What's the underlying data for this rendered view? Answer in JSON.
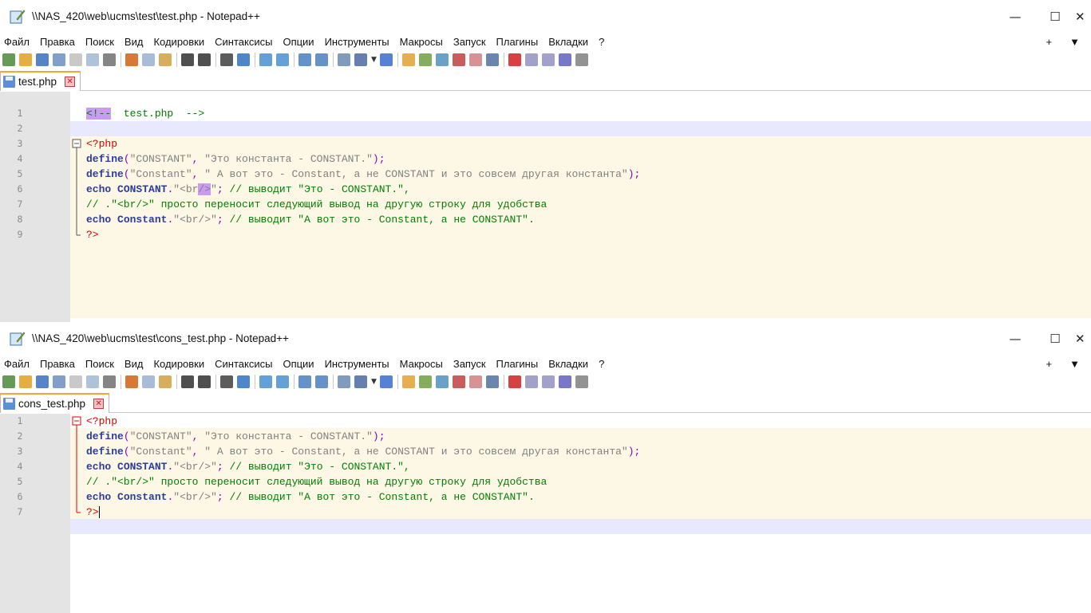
{
  "windows": [
    {
      "title": "\\\\NAS_420\\web\\ucms\\test\\test.php - Notepad++",
      "tab": "test.php",
      "lines": [
        {
          "num": "1",
          "text": [
            "<!--",
            "  test.php  -->"
          ]
        },
        {
          "num": "2",
          "text": [
            ""
          ]
        },
        {
          "num": "3",
          "text": [
            "<?php"
          ]
        },
        {
          "num": "4",
          "text": [
            "define",
            "(",
            "\"CONSTANT\"",
            ", ",
            "\"Это константа - CONSTANT.\"",
            ");"
          ]
        },
        {
          "num": "5",
          "text": [
            "define",
            "(",
            "\"Constant\"",
            ", ",
            "\" А вот это - Constant, а не CONSTANT и это совсем другая константа\"",
            ");"
          ]
        },
        {
          "num": "6",
          "text": [
            "echo",
            " ",
            "CONSTANT",
            ".",
            "\"<br",
            "/>",
            "\"",
            "; ",
            "// выводит \"Это - CONSTANT.\","
          ]
        },
        {
          "num": "7",
          "text": [
            "// .\"<br/>\" просто переносит следующий вывод на другую строку для удобства"
          ]
        },
        {
          "num": "8",
          "text": [
            "echo",
            " ",
            "Constant",
            ".",
            "\"<br/>\"",
            "; ",
            "// выводит \"А вот это - Constant, а не CONSTANT\"."
          ]
        },
        {
          "num": "9",
          "text": [
            "?>"
          ]
        }
      ]
    },
    {
      "title": "\\\\NAS_420\\web\\ucms\\test\\cons_test.php - Notepad++",
      "tab": "cons_test.php",
      "lines": [
        {
          "num": "1",
          "text": [
            "<?php"
          ]
        },
        {
          "num": "2",
          "text": [
            "define",
            "(",
            "\"CONSTANT\"",
            ", ",
            "\"Это константа - CONSTANT.\"",
            ");"
          ]
        },
        {
          "num": "3",
          "text": [
            "define",
            "(",
            "\"Constant\"",
            ", ",
            "\" А вот это - Constant, а не CONSTANT и это совсем другая константа\"",
            ");"
          ]
        },
        {
          "num": "4",
          "text": [
            "echo",
            " ",
            "CONSTANT",
            ".",
            "\"<br/>\"",
            "; ",
            "// выводит \"Это - CONSTANT.\","
          ]
        },
        {
          "num": "5",
          "text": [
            "// .\"<br/>\" просто переносит следующий вывод на другую строку для удобства"
          ]
        },
        {
          "num": "6",
          "text": [
            "echo",
            " ",
            "Constant",
            ".",
            "\"<br/>\"",
            "; ",
            "// выводит \"А вот это - Constant, а не CONSTANT\"."
          ]
        },
        {
          "num": "7",
          "text": [
            "?>"
          ]
        }
      ]
    }
  ],
  "menu": [
    "Файл",
    "Правка",
    "Поиск",
    "Вид",
    "Кодировки",
    "Синтаксисы",
    "Опции",
    "Инструменты",
    "Макросы",
    "Запуск",
    "Плагины",
    "Вкладки",
    "?"
  ],
  "menu_right": [
    "+",
    "▼"
  ],
  "controls": {
    "minimize": "—",
    "maximize": "☐",
    "close": "✕",
    "tab_close": "✕"
  },
  "icons": [
    "new-file-icon",
    "open-file-icon",
    "save-icon",
    "save-all-icon",
    "close-icon",
    "close-all-icon",
    "print-icon",
    "cut-icon",
    "copy-icon",
    "paste-icon",
    "undo-icon",
    "redo-icon",
    "find-icon",
    "replace-icon",
    "zoom-in-icon",
    "zoom-out-icon",
    "sync-vertical-icon",
    "sync-horizontal-icon",
    "word-wrap-icon",
    "show-all-chars-icon",
    "indent-guide-icon",
    "udl-icon",
    "doc-map-icon",
    "function-list-icon",
    "folder-workspace-icon",
    "monitoring-icon",
    "eye-icon",
    "record-macro-icon",
    "stop-macro-icon",
    "play-macro-icon",
    "run-macro-multiple-icon",
    "save-macro-icon"
  ]
}
